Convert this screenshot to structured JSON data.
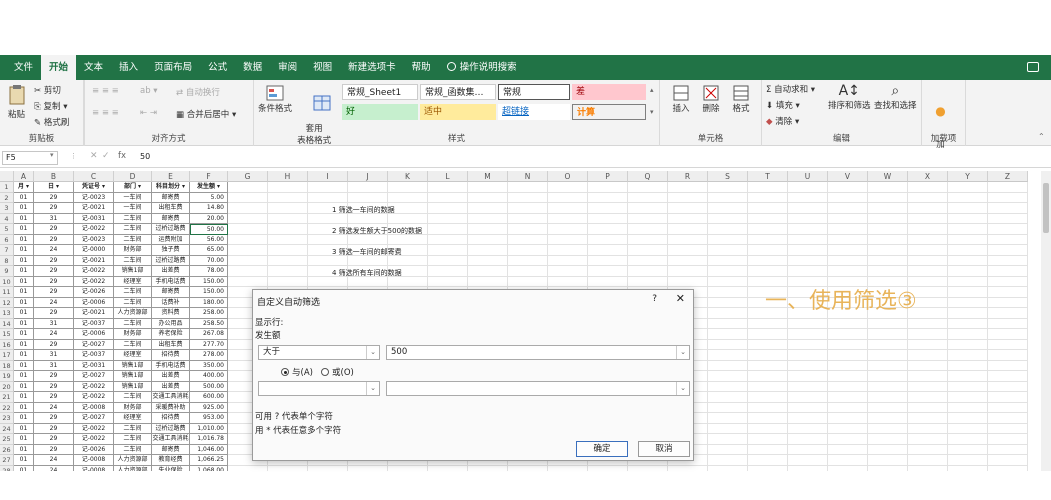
{
  "tabs": [
    "文件",
    "开始",
    "文本",
    "插入",
    "页面布局",
    "公式",
    "数据",
    "审阅",
    "视图",
    "新建选项卡",
    "帮助",
    "操作说明搜索"
  ],
  "active_tab": "开始",
  "ribbon": {
    "clipboard": {
      "paste": "粘贴",
      "cut": "剪切",
      "copy": "复制",
      "format_painter": "格式刷",
      "label": "剪贴板"
    },
    "alignment": {
      "wrap": "自动换行",
      "merge": "合并后居中",
      "label": "对齐方式"
    },
    "styles": {
      "cond_format": "条件格式",
      "table_format": "套用\n表格格式",
      "cells": [
        "常规_Sheet1",
        "常规_函数集…",
        "常规",
        "差",
        "好",
        "适中",
        "超链接",
        "计算"
      ],
      "label": "样式"
    },
    "cells_group": {
      "insert": "插入",
      "delete": "删除",
      "format": "格式",
      "label": "单元格"
    },
    "editing": {
      "autosum": "自动求和",
      "fill": "填充",
      "clear": "清除",
      "sort": "排序和筛选",
      "find": "查找和选择",
      "label": "编辑"
    },
    "addins": {
      "btn": "加\n载项",
      "label": "加载项"
    }
  },
  "formula_bar": {
    "namebox": "F5",
    "fx": "fx",
    "value": "50"
  },
  "columns": [
    "A",
    "B",
    "C",
    "D",
    "E",
    "F",
    "G",
    "H",
    "I",
    "J",
    "K",
    "L",
    "M",
    "N",
    "O",
    "P",
    "Q",
    "R",
    "S",
    "T",
    "U",
    "V",
    "W",
    "X",
    "Y",
    "Z"
  ],
  "table_header": [
    "月",
    "日",
    "凭证号",
    "部门",
    "科目划分",
    "发生额"
  ],
  "rows": [
    [
      "01",
      "29",
      "记-0023",
      "一车间",
      "邮寄费",
      "5.00"
    ],
    [
      "01",
      "29",
      "记-0021",
      "一车间",
      "出租车费",
      "14.80"
    ],
    [
      "01",
      "31",
      "记-0031",
      "二车间",
      "邮寄费",
      "20.00"
    ],
    [
      "01",
      "29",
      "记-0022",
      "二车间",
      "过桥过路费",
      "50.00"
    ],
    [
      "01",
      "29",
      "记-0023",
      "二车间",
      "运费附加",
      "56.00"
    ],
    [
      "01",
      "24",
      "记-0000",
      "财务部",
      "独子费",
      "65.00"
    ],
    [
      "01",
      "29",
      "记-0021",
      "二车间",
      "过桥过路费",
      "70.00"
    ],
    [
      "01",
      "29",
      "记-0022",
      "销售1部",
      "出差费",
      "78.00"
    ],
    [
      "01",
      "29",
      "记-0022",
      "经理室",
      "手机电话费",
      "150.00"
    ],
    [
      "01",
      "29",
      "记-0026",
      "二车间",
      "邮寄费",
      "150.00"
    ],
    [
      "01",
      "24",
      "记-0006",
      "二车间",
      "话费补",
      "180.00"
    ],
    [
      "01",
      "29",
      "记-0021",
      "人力资源部",
      "资料费",
      "258.00"
    ],
    [
      "01",
      "31",
      "记-0037",
      "二车间",
      "办公用品",
      "258.50"
    ],
    [
      "01",
      "24",
      "记-0006",
      "财务部",
      "养老保险",
      "267.08"
    ],
    [
      "01",
      "29",
      "记-0027",
      "二车间",
      "出租车费",
      "277.70"
    ],
    [
      "01",
      "31",
      "记-0037",
      "经理室",
      "招待费",
      "278.00"
    ],
    [
      "01",
      "31",
      "记-0031",
      "销售1部",
      "手机电话费",
      "350.00"
    ],
    [
      "01",
      "29",
      "记-0027",
      "销售1部",
      "出差费",
      "400.00"
    ],
    [
      "01",
      "29",
      "记-0022",
      "销售1部",
      "出差费",
      "500.00"
    ],
    [
      "01",
      "29",
      "记-0022",
      "二车间",
      "交通工具消耗",
      "600.00"
    ],
    [
      "01",
      "24",
      "记-0008",
      "财务部",
      "采暖费补助",
      "925.00"
    ],
    [
      "01",
      "29",
      "记-0027",
      "经理室",
      "招待费",
      "953.00"
    ],
    [
      "01",
      "29",
      "记-0022",
      "二车间",
      "过桥过路费",
      "1,010.00"
    ],
    [
      "01",
      "29",
      "记-0022",
      "二车间",
      "交通工具消耗",
      "1,016.78"
    ],
    [
      "01",
      "29",
      "记-0026",
      "二车间",
      "邮寄费",
      "1,046.00"
    ],
    [
      "01",
      "24",
      "记-0008",
      "人力资源部",
      "教育经费",
      "1,066.25"
    ],
    [
      "01",
      "24",
      "记-0008",
      "人力资源部",
      "失业保险",
      "1,068.00"
    ]
  ],
  "notes": [
    "1 筛选一车间的数据",
    "2 筛选发生额大于500的数据",
    "3 筛选一车间的邮寄费",
    "4 筛选所有车间的数据"
  ],
  "big_title": "一、使用筛选③",
  "dialog": {
    "title": "自定义自动筛选",
    "help": "?",
    "close": "✕",
    "show_rows": "显示行:",
    "field": "发生额",
    "op1": "大于",
    "val1": "500",
    "and": "与(A)",
    "or": "或(O)",
    "op2": "",
    "val2": "",
    "hint1": "可用 ? 代表单个字符",
    "hint2": "用 * 代表任意多个字符",
    "ok": "确定",
    "cancel": "取消"
  }
}
